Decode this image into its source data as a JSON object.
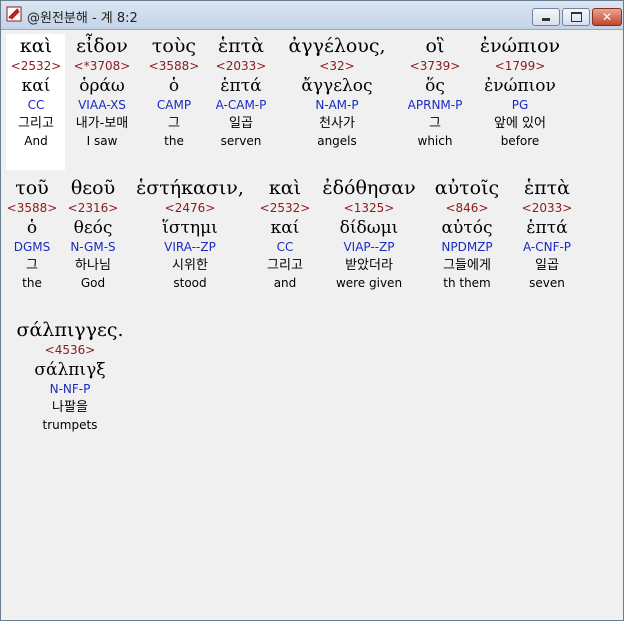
{
  "window": {
    "title": "@원전분해 - 계 8:2",
    "min_glyph": "",
    "max_glyph": "",
    "close_glyph": "✕"
  },
  "words": [
    {
      "greek": "καὶ",
      "strong": "<2532>",
      "lemma": "καί",
      "morph": "CC",
      "korean": "그리고",
      "english": "And"
    },
    {
      "greek": "εἶδον",
      "strong": "<*3708>",
      "lemma": "ὁράω",
      "morph": "VIAA-XS",
      "korean": "내가-보매",
      "english": "I saw"
    },
    {
      "greek": "τοὺς",
      "strong": "<3588>",
      "lemma": "ὁ",
      "morph": "CAMP",
      "korean": "그",
      "english": "the"
    },
    {
      "greek": "ἑπτὰ",
      "strong": "<2033>",
      "lemma": "ἑπτά",
      "morph": "A-CAM-P",
      "korean": "일곱",
      "english": "serven"
    },
    {
      "greek": "ἀγγέλους,",
      "strong": "<32>",
      "lemma": "ἄγγελος",
      "morph": "N-AM-P",
      "korean": "천사가",
      "english": "angels"
    },
    {
      "greek": "οἳ",
      "strong": "<3739>",
      "lemma": "ὅς",
      "morph": "APRNM-P",
      "korean": "그",
      "english": "which"
    },
    {
      "greek": "ἐνώπιον",
      "strong": "<1799>",
      "lemma": "ἐνώπιον",
      "morph": "PG",
      "korean": "앞에 있어",
      "english": "before"
    },
    {
      "greek": "τοῦ",
      "strong": "<3588>",
      "lemma": "ὁ",
      "morph": "DGMS",
      "korean": "그",
      "english": "the"
    },
    {
      "greek": "θεοῦ",
      "strong": "<2316>",
      "lemma": "θεός",
      "morph": "N-GM-S",
      "korean": "하나님",
      "english": "God"
    },
    {
      "greek": "ἑστήκασιν,",
      "strong": "<2476>",
      "lemma": "ἵστημι",
      "morph": "VIRA--ZP",
      "korean": "시위한",
      "english": "stood"
    },
    {
      "greek": "καὶ",
      "strong": "<2532>",
      "lemma": "καί",
      "morph": "CC",
      "korean": "그리고",
      "english": "and"
    },
    {
      "greek": "ἐδόθησαν",
      "strong": "<1325>",
      "lemma": "δίδωμι",
      "morph": "VIAP--ZP",
      "korean": "받았더라",
      "english": "were given"
    },
    {
      "greek": "αὐτοῖς",
      "strong": "<846>",
      "lemma": "αὐτός",
      "morph": "NPDMZP",
      "korean": "그들에게",
      "english": "th them"
    },
    {
      "greek": "ἑπτὰ",
      "strong": "<2033>",
      "lemma": "ἑπτά",
      "morph": "A-CNF-P",
      "korean": "일곱",
      "english": "seven"
    },
    {
      "greek": "σάλπιγγες.",
      "strong": "<4536>",
      "lemma": "σάλπιγξ",
      "morph": "N-NF-P",
      "korean": "나팔을",
      "english": "trumpets"
    }
  ]
}
